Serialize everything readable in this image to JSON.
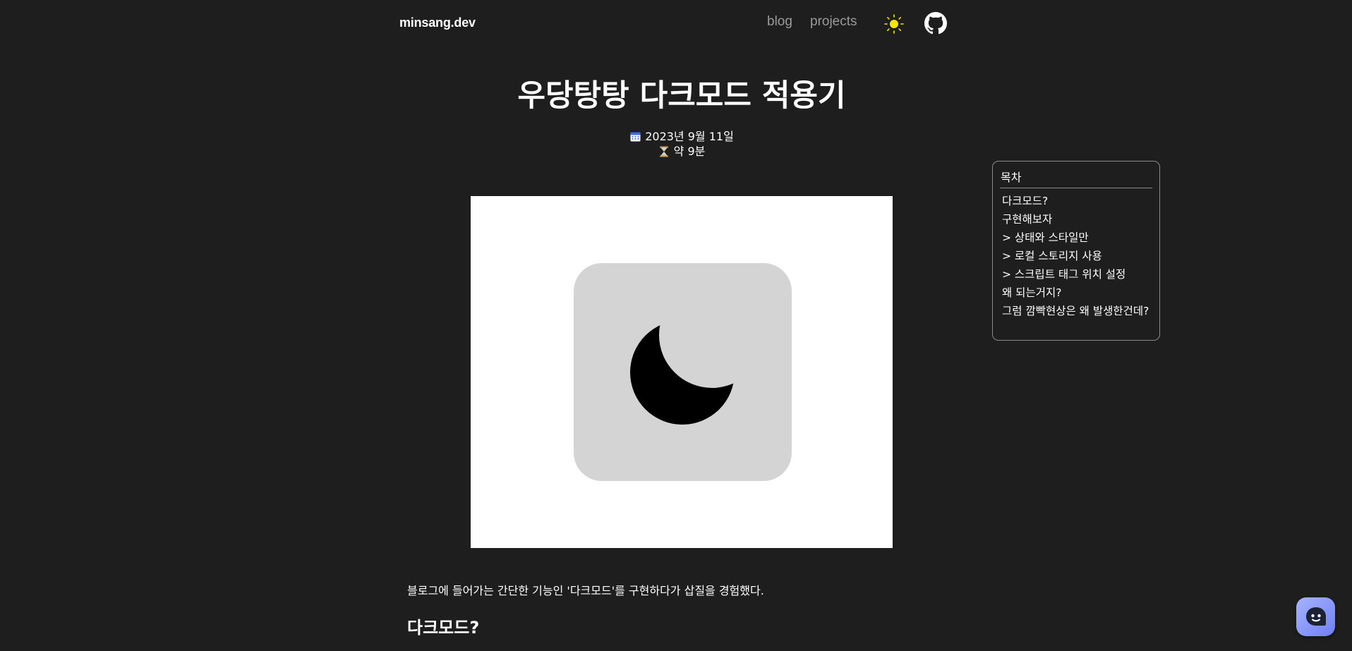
{
  "header": {
    "logo": "minsang.dev",
    "nav": {
      "blog": "blog",
      "projects": "projects"
    },
    "icons": {
      "theme": "sun-icon",
      "github": "github-icon"
    }
  },
  "post": {
    "title": "우당탕탕 다크모드 적용기",
    "date": "2023년 9월 11일",
    "read_time": "약 9분",
    "intro": "블로그에 들어가는 간단한 기능인 '다크모드'를 구현하다가 삽질을 경험했다.",
    "first_heading": "다크모드?"
  },
  "toc": {
    "title": "목차",
    "items": [
      "다크모드?",
      "구현해보자",
      "> 상태와 스타일만",
      "> 로컬 스토리지 사용",
      "> 스크립트 태그 위치 설정",
      "왜 되는거지?",
      "그럼 깜빡현상은 왜 발생한건데?"
    ]
  },
  "colors": {
    "background": "#1e1e1e",
    "text": "#ffffff",
    "nav_muted": "#9a9a9a",
    "sun": "#f5e600",
    "chat_accent": "#7f8cf8"
  }
}
